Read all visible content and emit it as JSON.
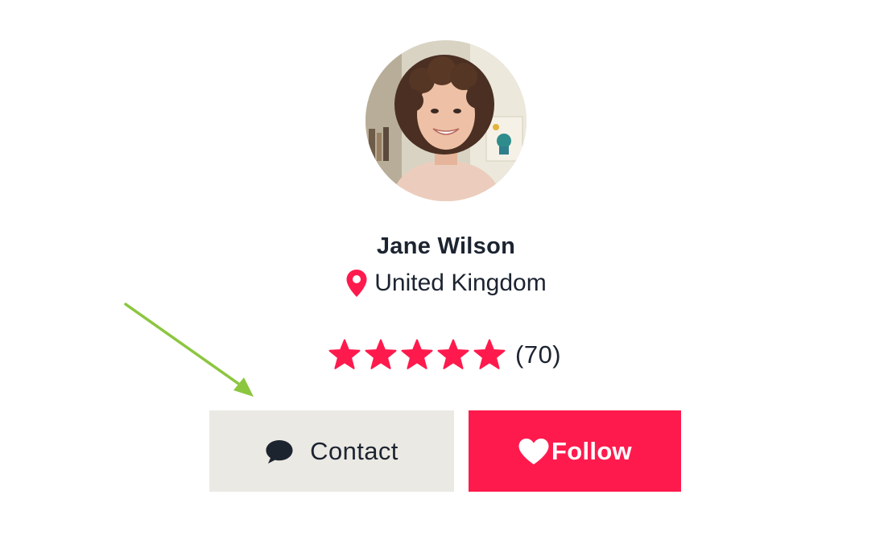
{
  "profile": {
    "name": "Jane Wilson",
    "location": "United Kingdom",
    "rating": {
      "stars": 5,
      "max_stars": 5,
      "count_text": "(70)"
    }
  },
  "actions": {
    "contact_label": "Contact",
    "follow_label": "Follow"
  },
  "icons": {
    "location": "map-pin-icon",
    "star": "star-icon",
    "contact": "speech-bubble-icon",
    "follow": "heart-icon"
  },
  "colors": {
    "accent": "#ff1a4d",
    "text": "#1c2430",
    "contact_bg": "#ebe9e3",
    "annotation": "#8cc63f"
  }
}
